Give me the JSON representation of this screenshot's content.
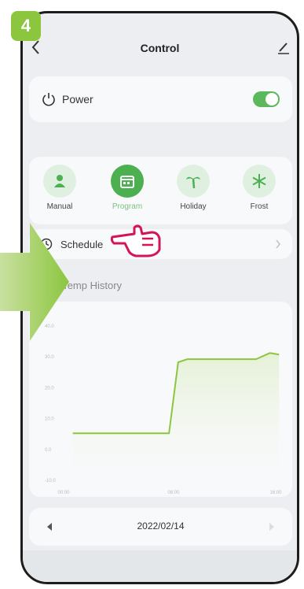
{
  "step_number": "4",
  "header": {
    "title": "Control"
  },
  "power": {
    "label": "Power",
    "on": true
  },
  "modes": [
    {
      "label": "Manual",
      "icon": "person-icon",
      "active": false
    },
    {
      "label": "Program",
      "icon": "calendar-icon",
      "active": true
    },
    {
      "label": "Holiday",
      "icon": "palm-tree-icon",
      "active": false
    },
    {
      "label": "Frost",
      "icon": "snowflake-icon",
      "active": false
    }
  ],
  "schedule": {
    "label": "Schedule"
  },
  "history": {
    "title": "m Temp History"
  },
  "chart_data": {
    "type": "line",
    "x_ticks": [
      "00:00",
      "08:00",
      "16:00"
    ],
    "y_ticks": [
      "40.0",
      "30.0",
      "20.0",
      "10.0",
      "0.0",
      "-10.0"
    ],
    "ylim": [
      -10,
      40
    ],
    "xlim": [
      0,
      24
    ],
    "grid": false,
    "series": [
      {
        "x": [
          1,
          11.5,
          12.5,
          13.5,
          21,
          22.5,
          23.5
        ],
        "y": [
          5,
          5,
          28,
          29,
          29,
          31,
          30.5
        ]
      }
    ],
    "line_color": "#8cc63f"
  },
  "date_nav": {
    "date": "2022/02/14"
  },
  "colors": {
    "accent": "#4caf50",
    "badge": "#8cc63f"
  }
}
